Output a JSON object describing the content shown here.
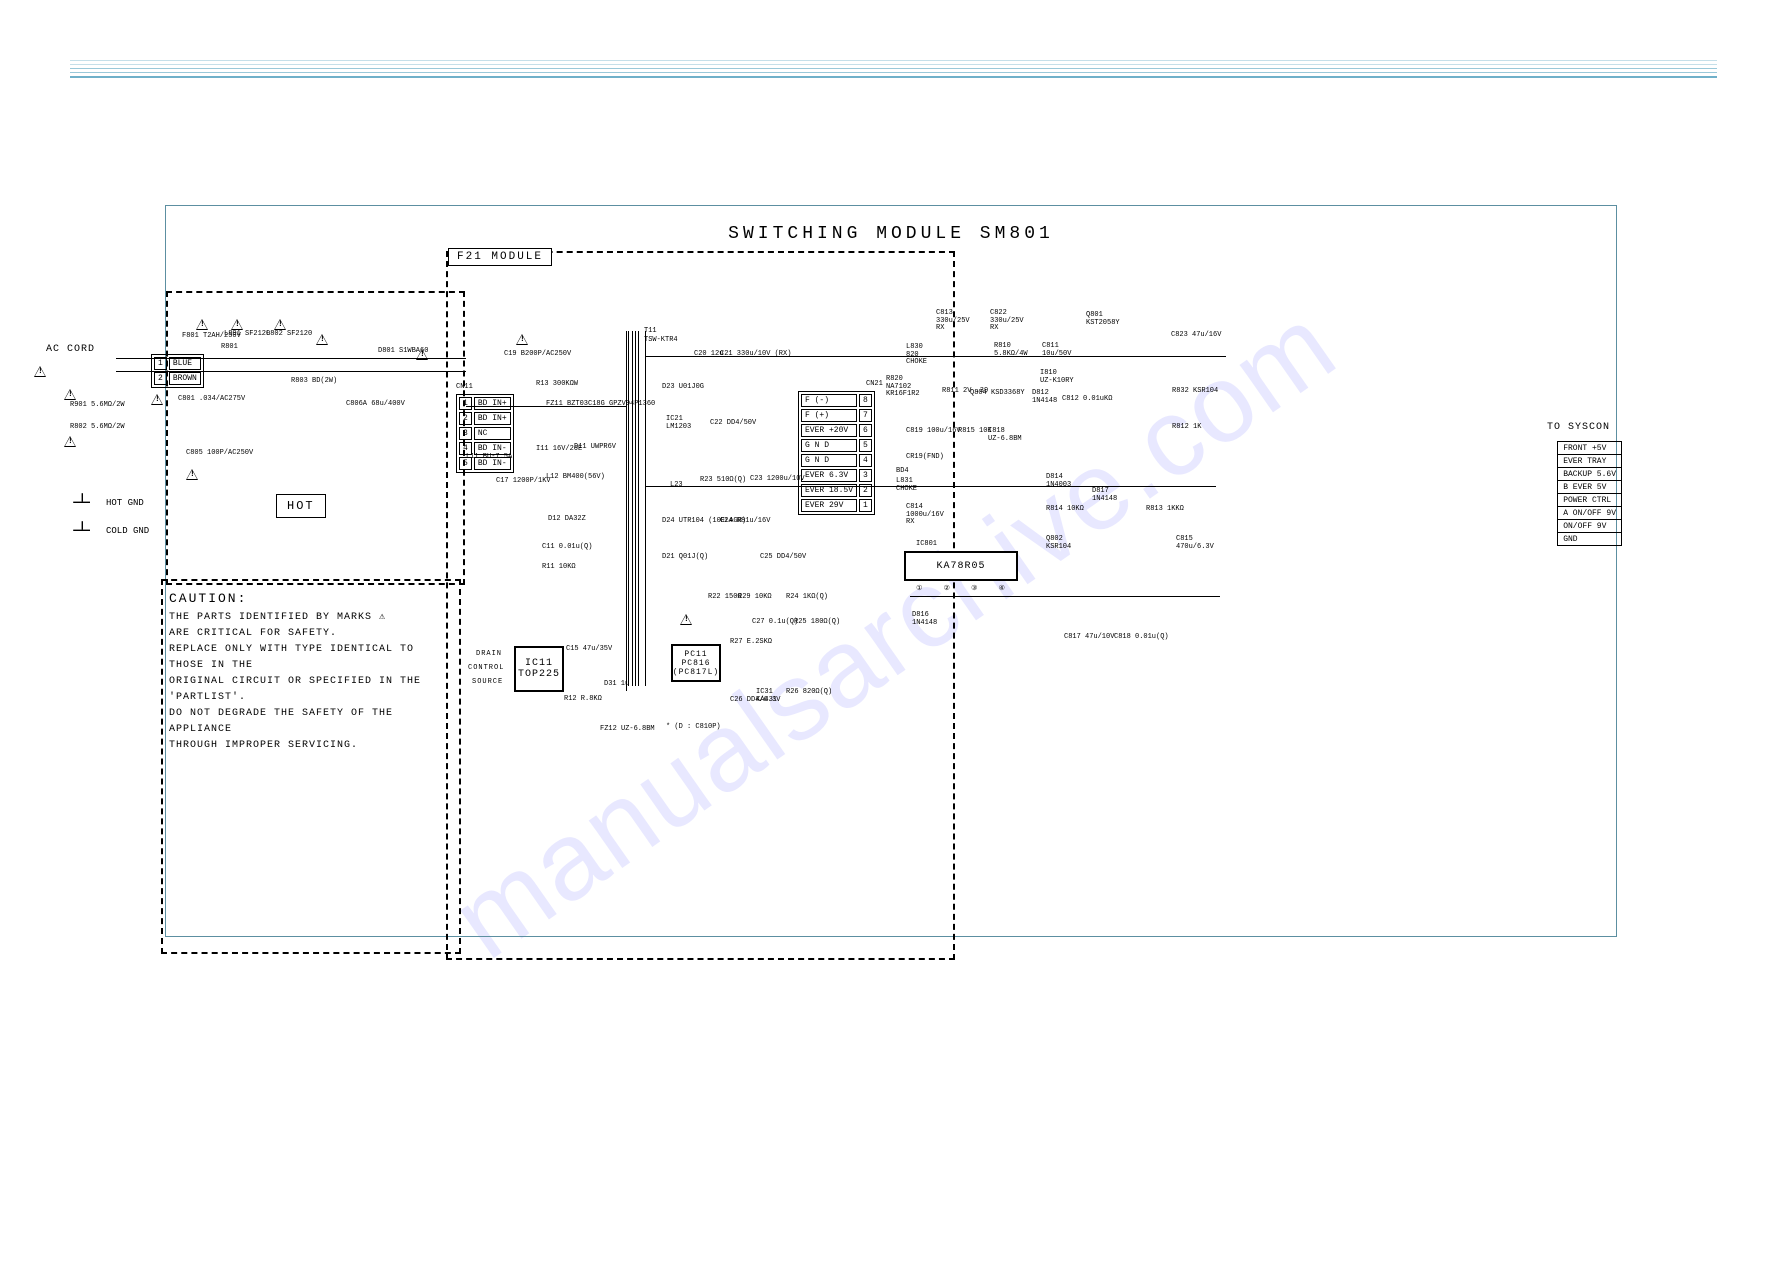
{
  "meta": {
    "watermark": "manualsarchive.com"
  },
  "title": "SWITCHING MODULE   SM801",
  "module_tag": "F21 MODULE",
  "hot_label": "HOT",
  "hot_gnd_label": "HOT GND",
  "cold_gnd_label": "COLD GND",
  "caution": {
    "heading": "CAUTION:",
    "line1": "THE PARTS IDENTIFIED BY MARKS ⚠",
    "line2": "ARE CRITICAL FOR SAFETY.",
    "line3": "REPLACE ONLY WITH TYPE IDENTICAL TO THOSE IN THE",
    "line4": "ORIGINAL CIRCUIT OR SPECIFIED IN THE 'PARTLIST'.",
    "line5": "DO NOT DEGRADE THE SAFETY OF THE APPLIANCE",
    "line6": "THROUGH IMPROPER SERVICING."
  },
  "ac_cord_label": "AC CORD",
  "ac_conn": {
    "rows": [
      [
        "1",
        "BLUE"
      ],
      [
        "2",
        "BROWN"
      ]
    ]
  },
  "cn11_in": {
    "name": "CN11",
    "rows": [
      [
        "1",
        "BD IN+"
      ],
      [
        "2",
        "BD IN+"
      ],
      [
        "3",
        "NC"
      ],
      [
        "4",
        "BD IN-"
      ],
      [
        "5",
        "BD IN-"
      ]
    ]
  },
  "cn21_out": {
    "name": "CN21",
    "rows": [
      [
        "F (-)",
        "8"
      ],
      [
        "F (+)",
        "7"
      ],
      [
        "EVER +20V",
        "6"
      ],
      [
        "G N D",
        "5"
      ],
      [
        "G N D",
        "4"
      ],
      [
        "EVER 6.3V",
        "3"
      ],
      [
        "EVER 18.5V",
        "2"
      ],
      [
        "EVER 29V",
        "1"
      ]
    ]
  },
  "right_bus_label": "TO SYSCON",
  "outputs": [
    "FRONT +5V",
    "EVER TRAY",
    "BACKUP 5.6V",
    "B EVER 5V",
    "POWER CTRL",
    "A ON/OFF 9V",
    "ON/OFF 9V",
    "GND"
  ],
  "ic_labels": {
    "ic21": "IC21\nLM1203",
    "ic801": "IC801",
    "ic801_pn": "KA78R05",
    "ic11": "IC11\nTOP225",
    "pc11": "PC11\nPC816\n(PC817L)",
    "ic31": "IC31\nKA431"
  },
  "flyback": {
    "ref": "T11",
    "pn": "TSW-KTR4"
  },
  "components": {
    "F801": "F801\nT2AH/250V",
    "R801": "R801",
    "L801": "L801\nSF2120",
    "L802": "L802\nSF2120",
    "D801": "D801\nS1WBA60",
    "R803": "R803\nBD(2W)",
    "C801": "C801\n.034/AC275V",
    "R901": "R901\n5.6MΩ/2W",
    "R802": "R802\n5.6MΩ/2W",
    "C805": "C805\n100P/AC250V",
    "C806A": "C806A\n68u/400V",
    "C19": "C19\nB200P/AC250V",
    "R13": "R13\n300KΩW",
    "FZ11": "FZ11\nBZT03C18G\nGPZV94P1360",
    "L11": "L11\nBU-7.5A",
    "I11": "I11\n16V/26E",
    "D11": "D11\nUWPR6V",
    "C17": "C17\n1200P/1KV",
    "L12": "L12\nBM400(56V)",
    "D12": "D12\nDA32Z",
    "C11": "C11\n0.01u(Q)",
    "R11": "R11\n10KΩ",
    "C15": "C15\n47u/35V",
    "D31": "D31\n1u",
    "R12": "R12\nR.8KΩ",
    "FZ12": "FZ12\nUZ-6.8BM",
    "D23": "D23\nU01J0G",
    "C22": "C22\nDD4/50V",
    "L23": "L23",
    "R23": "R23\n510Ω(Q)",
    "C23": "C23\n1200u/10V",
    "D24": "D24\nUTR104\n(10ELAGR)",
    "C24": "C24\nR81u/16V",
    "D21": "D21\nQ01J(Q)",
    "C25": "C25\nDD4/50V",
    "R22": "R22\n150Ω",
    "R29": "R29\n10KΩ",
    "R24": "R24\n1KΩ(Q)",
    "C27": "C27\n0.1u(Q)",
    "R27": "R27\nE.2SKΩ",
    "R25": "R25\n180Ω(Q)",
    "C26": "C26\nDD4/6.3V",
    "R26": "R26\n820Ω(Q)",
    "C20": "C20\n12u",
    "C21": "C21\n330u/10V (RX)",
    "C813": "C813\n330u/25V\nRX",
    "C822": "C822\n330u/25V\nRX",
    "L830": "L830\n820\nCHOKE",
    "R820": "R820\nNA7102\nKR16F1R2",
    "R810": "R810\n5.8KΩ/4W",
    "C811": "C811\n10u/50V",
    "Q801": "Q801\nKST2058Y",
    "C823": "C823\n47u/16V",
    "R811": "R811\n2V .39",
    "I810": "I810\nUZ-K10RY",
    "Q804": "Q804\nKSD3368Y",
    "D812": "D812\n1N4148",
    "C812": "C812\n0.01uKΩ",
    "R832": "R832\nKSR104",
    "C819": "C819\n100u/16V",
    "R815": "R815\n10K",
    "I818": "I818\nUZ-6.8BM",
    "R812": "R812\n1K",
    "CR19_FND": "CR19(FND)",
    "BD4": "BD4",
    "L831": "L831\nCHOKE",
    "C814": "C814\n1000u/16V\nRX",
    "D814": "D814\n1N4003",
    "D817": "D817\n1N4148",
    "R814": "R814\n10KΩ",
    "R813": "R813\n1KKΩ",
    "Q802": "Q802\nKSR104",
    "C815": "C815\n470u/6.3V",
    "D816": "D816\n1N4148",
    "C817": "C817\n47u/10V",
    "C818": "C818\n0.01u(Q)",
    "D806": "* (D : C810P)"
  },
  "ic11_pins": [
    "DRAIN",
    "CONTROL",
    "SOURCE"
  ]
}
